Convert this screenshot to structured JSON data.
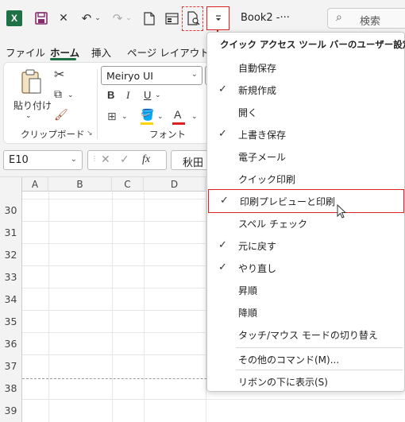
{
  "titlebar": {
    "excel_logo": "X",
    "doc_title": "Book2  -···",
    "search_placeholder": "検索"
  },
  "tabs": [
    {
      "label": "ファイル"
    },
    {
      "label": "ホーム",
      "active": true
    },
    {
      "label": "挿入"
    },
    {
      "label": "ページ レイアウト"
    }
  ],
  "ribbon": {
    "paste_label": "貼り付け",
    "clipboard_label": "クリップボード",
    "font_label": "フォント",
    "font_name": "Meiryo UI",
    "bold": "B",
    "italic": "I",
    "underline": "U",
    "font_color_glyph": "A",
    "colors": {
      "highlight": "#ffd400",
      "font_color": "#e02020"
    }
  },
  "formula_bar": {
    "name_box": "E10",
    "fx": "fx",
    "content": "秋田"
  },
  "grid": {
    "columns": [
      "A",
      "B",
      "C",
      "D"
    ],
    "rows": [
      "30",
      "31",
      "32",
      "33",
      "34",
      "35",
      "36",
      "37",
      "38",
      "39"
    ]
  },
  "qat_menu": {
    "title": "クイック アクセス ツール バーのユーザー設定",
    "items": [
      {
        "label": "自動保存",
        "checked": false
      },
      {
        "label": "新規作成",
        "checked": true
      },
      {
        "label": "開く",
        "checked": false
      },
      {
        "label": "上書き保存",
        "checked": true
      },
      {
        "label": "電子メール",
        "checked": false
      },
      {
        "label": "クイック印刷",
        "checked": false
      },
      {
        "label": "印刷プレビューと印刷",
        "checked": true,
        "highlighted": true
      },
      {
        "label": "スペル チェック",
        "checked": false
      },
      {
        "label": "元に戻す",
        "checked": true
      },
      {
        "label": "やり直し",
        "checked": true
      },
      {
        "label": "昇順",
        "checked": false
      },
      {
        "label": "降順",
        "checked": false
      },
      {
        "label": "タッチ/マウス モードの切り替え",
        "checked": false
      }
    ],
    "more_commands": "その他のコマンド(M)...",
    "show_below": "リボンの下に表示(S)",
    "check_glyph": "✓"
  }
}
